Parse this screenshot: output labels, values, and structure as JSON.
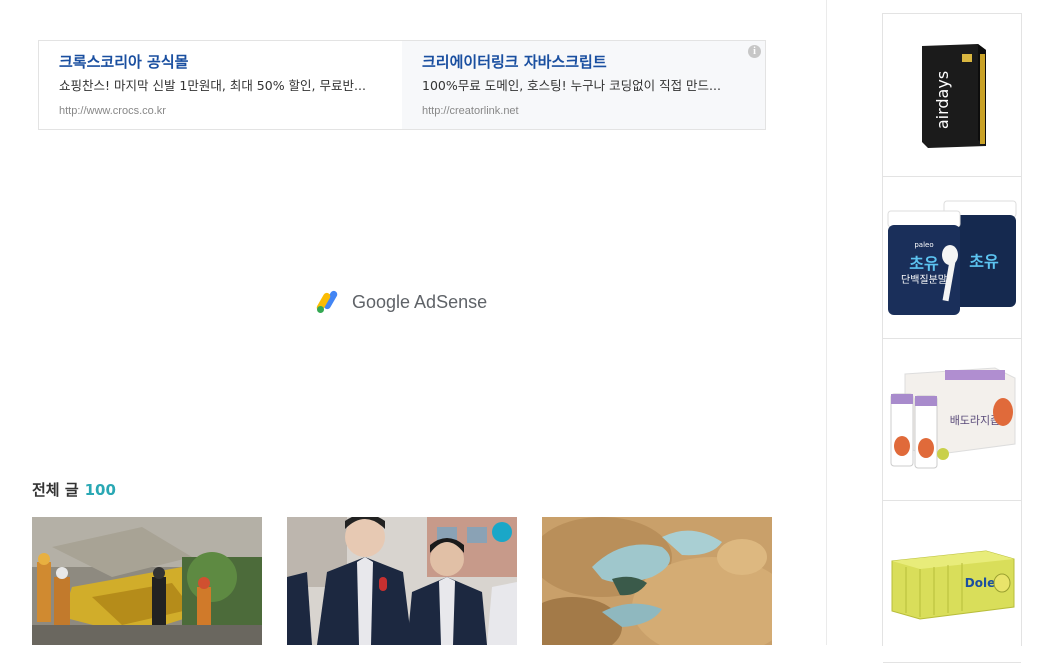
{
  "ads": [
    {
      "title": "크록스코리아 공식몰",
      "desc": "쇼핑찬스! 마지막 신발 1만원대, 최대 50% 할인, 무료반...",
      "url": "http://www.crocs.co.kr"
    },
    {
      "title": "크리에이터링크 자바스크립트",
      "desc": "100%무료 도메인, 호스팅! 누구나 코딩없이 직접 만드...",
      "url": "http://creatorlink.net"
    }
  ],
  "adsense_label": "Google AdSense",
  "section": {
    "title": "전체 글",
    "count": "100"
  },
  "thumbnails": [
    "collapse-rescue-photo",
    "students-uniform-photo",
    "food-closeup-photo"
  ],
  "products": [
    {
      "icon": "airdays-box",
      "box_text": "airdays"
    },
    {
      "icon": "paleo-colostrum-jars",
      "brand": "paleo",
      "label": "초유",
      "sub": "단백질분말"
    },
    {
      "icon": "bellflower-juice-box",
      "label": "배도라지즙"
    },
    {
      "icon": "dole-juice-pack",
      "brand": "Dole"
    }
  ],
  "colors": {
    "ad_title": "#1a4fa0",
    "count_accent": "#2aa8b4"
  }
}
